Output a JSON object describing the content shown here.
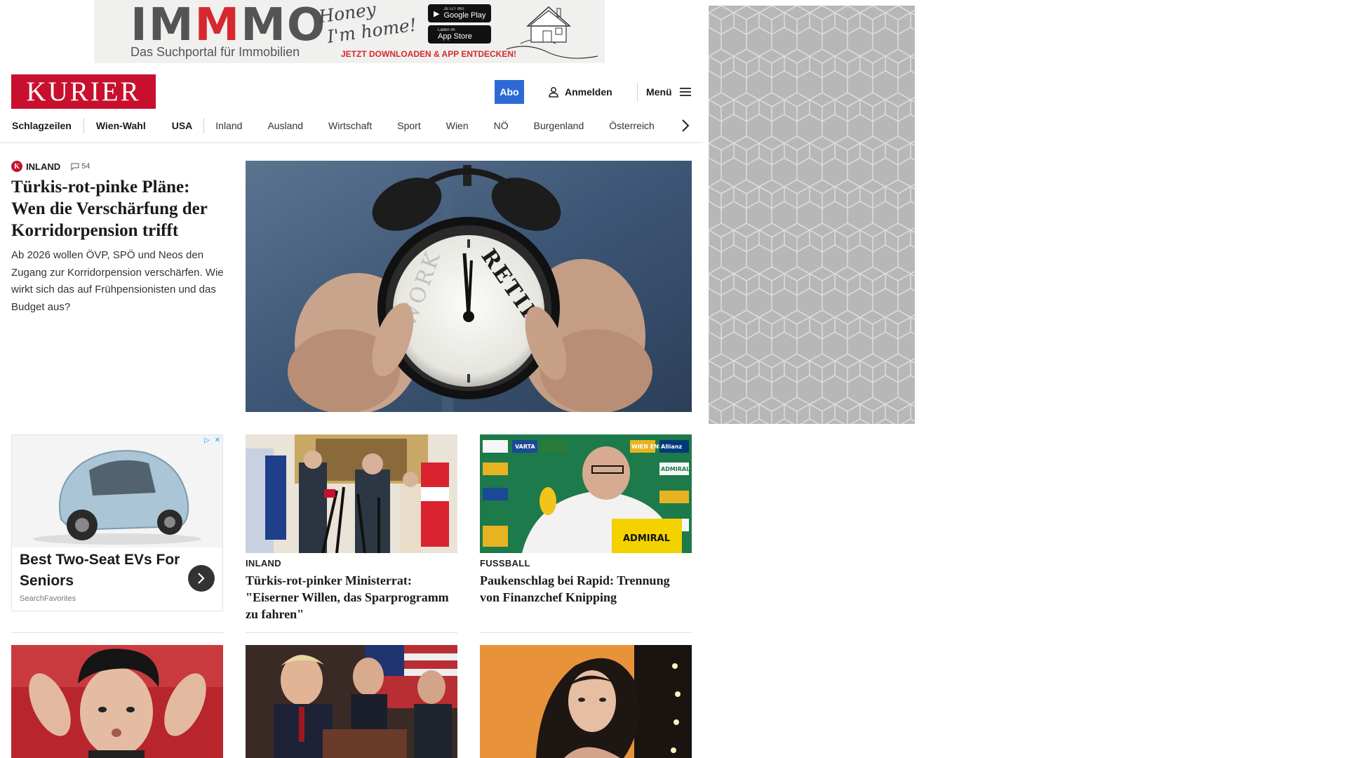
{
  "ad_banner": {
    "brand_left": "IM",
    "brand_mid": "M",
    "brand_right": "MO",
    "tagline": "Das Suchportal für Immobilien",
    "slogan_line1": "Honey",
    "slogan_line2": "I'm home!",
    "google_play_small": "JETZT BEI",
    "google_play": "Google Play",
    "app_store_small": "Laden im",
    "app_store": "App Store",
    "cta": "JETZT DOWNLOADEN & APP ENTDECKEN!"
  },
  "header": {
    "logo": "KURIER",
    "abo": "Abo",
    "login": "Anmelden",
    "menu": "Menü"
  },
  "nav": {
    "items": [
      "Schlagzeilen",
      "Wien-Wahl",
      "USA",
      "Inland",
      "Ausland",
      "Wirtschaft",
      "Sport",
      "Wien",
      "NÖ",
      "Burgenland",
      "Österreich"
    ]
  },
  "hero": {
    "kicker": "INLAND",
    "badge": "K",
    "comments": "54",
    "title": "Türkis-rot-pinke Pläne: Wen die Verschärfung der Korridorpension trifft",
    "teaser": "Ab 2026 wollen ÖVP, SPÖ und Neos den Zugang zur Korridorpension verschärfen. Wie wirkt sich das auf Frühpensionisten und das Budget aus?",
    "clock_word_left": "WORK",
    "clock_word_right": "RETIRE"
  },
  "ad_card": {
    "title": "Best Two-Seat EVs For Seniors",
    "source": "SearchFavorites"
  },
  "articles": [
    {
      "kicker": "INLAND",
      "title": "Türkis-rot-pinker Ministerrat: \"Eiserner Willen, das Sparprogramm zu fahren\""
    },
    {
      "kicker": "FUSSBALL",
      "title": "Paukenschlag bei Rapid: Trennung von Finanzchef Knipping",
      "backdrop_words": [
        "WIEN ENERGIE",
        "VARTA",
        "ADMIRAL",
        "Allianz"
      ],
      "sign": "ADMIRAL"
    }
  ]
}
